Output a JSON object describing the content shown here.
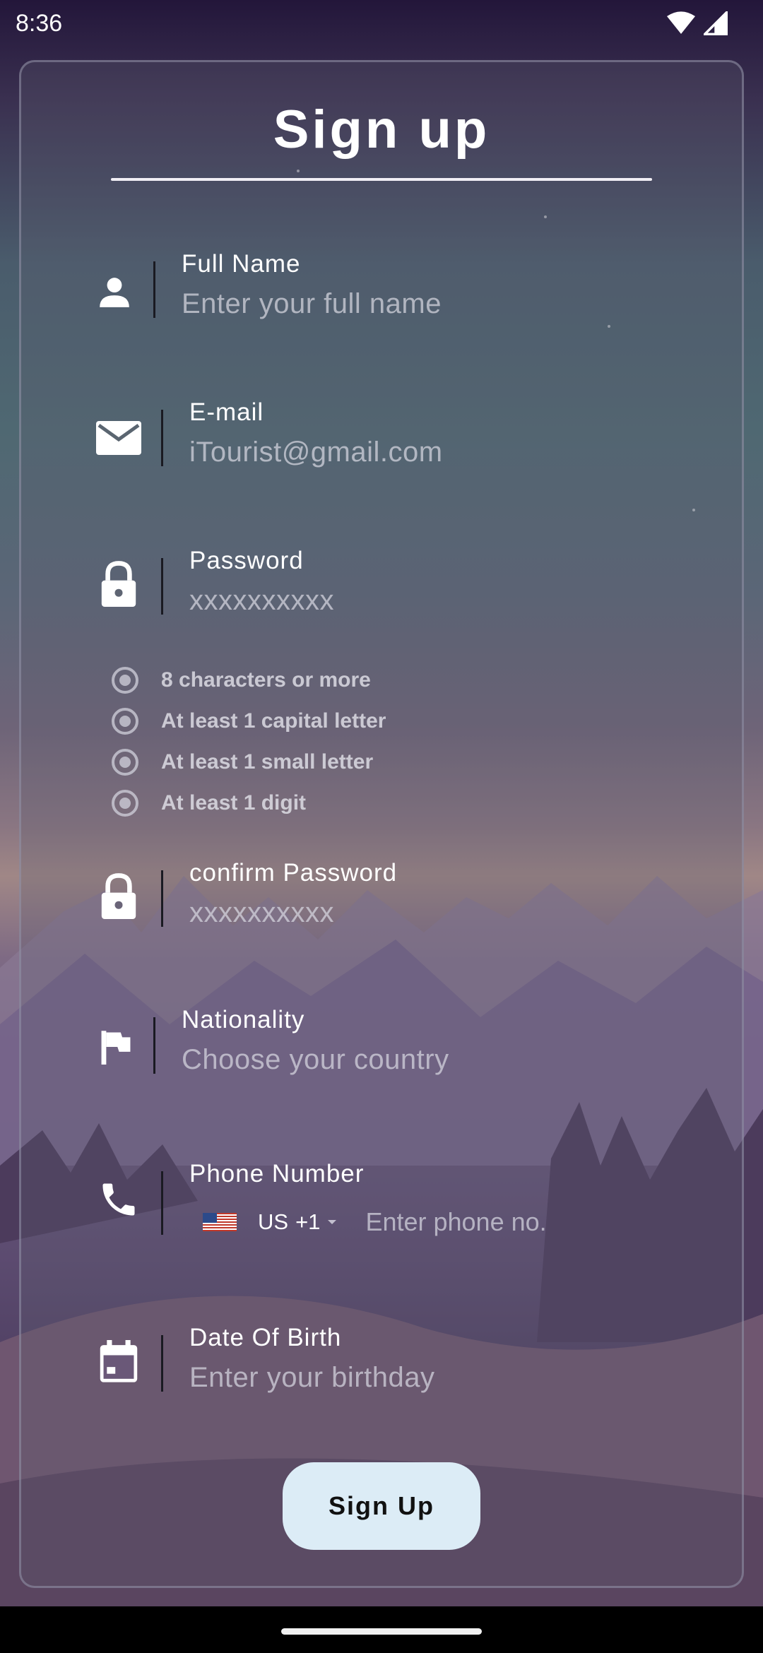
{
  "status_bar": {
    "time": "8:36"
  },
  "form": {
    "title": "Sign up",
    "fields": {
      "full_name": {
        "label": "Full Name",
        "placeholder": "Enter your full name"
      },
      "email": {
        "label": "E-mail",
        "placeholder": "iTourist@gmail.com"
      },
      "password": {
        "label": "Password",
        "placeholder": "xxxxxxxxxx"
      },
      "confirm_password": {
        "label": "confirm Password",
        "placeholder": "xxxxxxxxxx"
      },
      "nationality": {
        "label": "Nationality",
        "placeholder": "Choose your country"
      },
      "phone": {
        "label": "Phone Number",
        "country_code": "US",
        "dial_code": "+1",
        "placeholder": "Enter phone no."
      },
      "dob": {
        "label": "Date Of Birth",
        "placeholder": "Enter your birthday"
      }
    },
    "password_rules": [
      "8 characters or more",
      "At least 1 capital letter",
      "At least 1 small letter",
      "At least 1 digit"
    ],
    "submit_label": "Sign Up"
  },
  "icons": {
    "full_name": "person-icon",
    "email": "mail-icon",
    "password": "lock-icon",
    "confirm_password": "lock-icon",
    "nationality": "flag-icon",
    "phone": "phone-icon",
    "dob": "calendar-icon"
  },
  "colors": {
    "button_bg": "#dcecf6",
    "text_white": "#ffffff",
    "placeholder": "#d7d7e1"
  }
}
